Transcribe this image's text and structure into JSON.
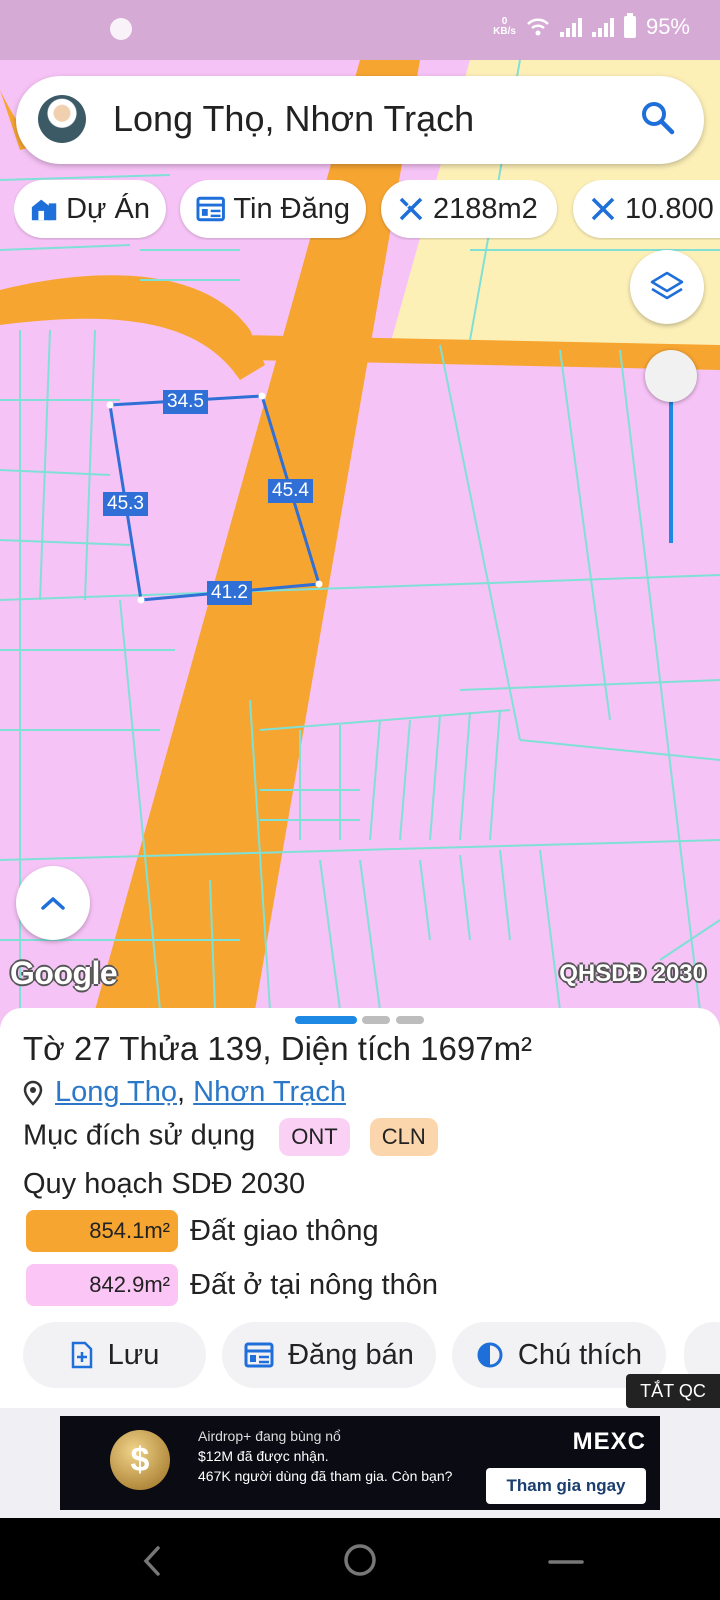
{
  "status_bar": {
    "battery": "95%",
    "net_speed_value": "0",
    "net_speed_unit": "KB/s"
  },
  "search": {
    "query": "Long Thọ, Nhơn Trạch"
  },
  "chips": [
    {
      "label": "Dự Án",
      "icon": "building-icon"
    },
    {
      "label": "Tin Đăng",
      "icon": "listing-icon"
    },
    {
      "label": "2188m2",
      "icon": "area-measure-icon"
    },
    {
      "label": "10.800",
      "icon": "area-measure-icon"
    }
  ],
  "map": {
    "edge_labels": [
      "34.5",
      "45.4",
      "45.3",
      "41.2"
    ],
    "google_logo": "Google",
    "plan_label": "QHSDĐ 2030",
    "colors": {
      "residential": "#f6c3f6",
      "road": "#f7a531",
      "boundary": "#7fe0d6",
      "parcel": "#2f6fd6"
    }
  },
  "sheet": {
    "title": "Tờ 27 Thửa 139, Diện tích 1697m²",
    "location_parts": [
      "Long Thọ",
      "Nhơn Trạch"
    ],
    "location_sep": ", ",
    "purpose_label": "Mục đích sử dụng",
    "purpose_tags": [
      {
        "code": "ONT",
        "bg": "#fbd0f5"
      },
      {
        "code": "CLN",
        "bg": "#fbd6ad"
      }
    ],
    "plan_heading": "Quy hoạch SDĐ 2030",
    "plan_rows": [
      {
        "area": "854.1m²",
        "label": "Đất giao thông",
        "color": "#f7a531"
      },
      {
        "area": "842.9m²",
        "label": "Đất ở tại nông thôn",
        "color": "#fbc5f5"
      }
    ]
  },
  "actions": [
    {
      "label": "Lưu",
      "icon": "add-file-icon"
    },
    {
      "label": "Đăng bán",
      "icon": "listing-icon"
    },
    {
      "label": "Chú thích",
      "icon": "contrast-icon"
    }
  ],
  "ad": {
    "close_label": "TẮT QC",
    "line1": "Airdrop+ đang bùng nổ",
    "line2": "$12M đã được nhận.",
    "line3": "467K người dùng đã tham gia. Còn bạn?",
    "brand": "MEXC",
    "cta": "Tham gia ngay"
  }
}
